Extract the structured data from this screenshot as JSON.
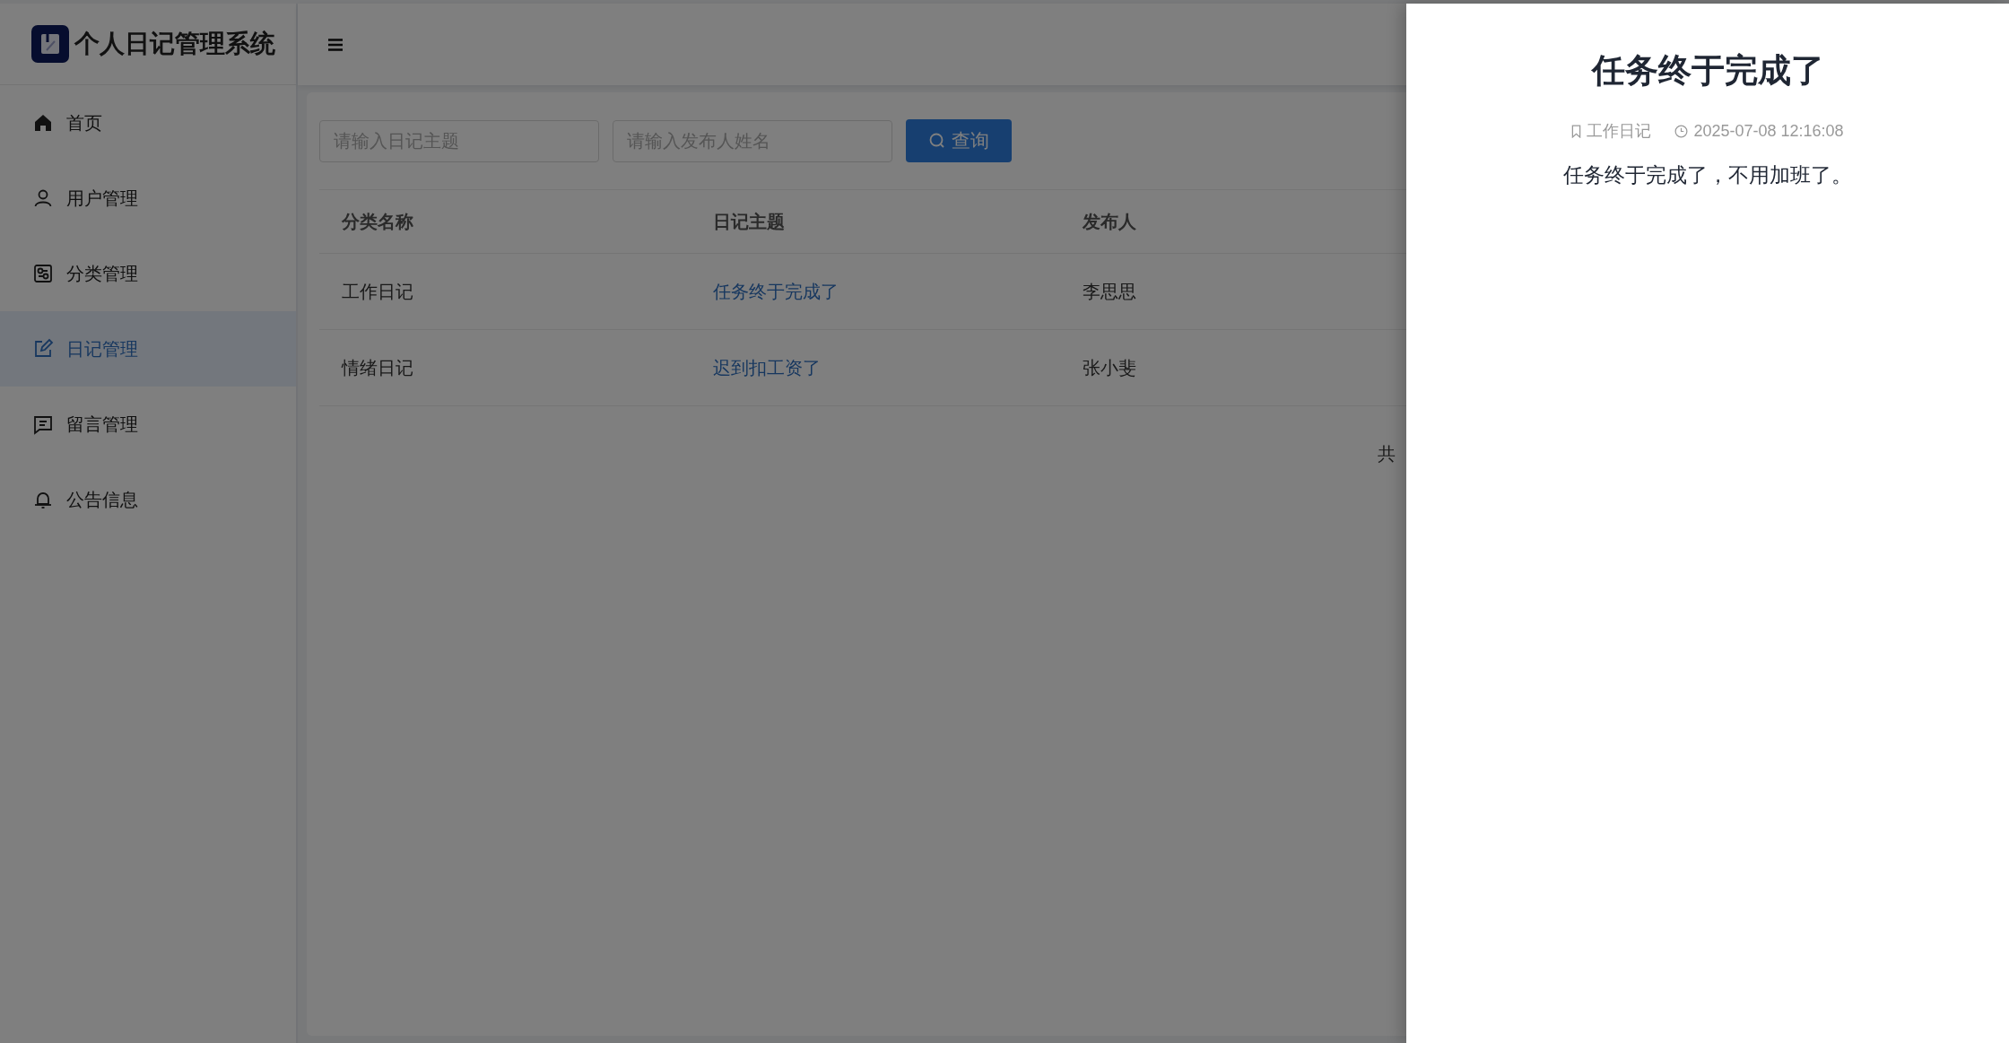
{
  "app": {
    "title": "个人日记管理系统"
  },
  "sidebar": {
    "items": [
      {
        "label": "首页",
        "kind": "home",
        "selected": false
      },
      {
        "label": "用户管理",
        "kind": "user",
        "selected": false
      },
      {
        "label": "分类管理",
        "kind": "category",
        "selected": false
      },
      {
        "label": "日记管理",
        "kind": "diary",
        "selected": true
      },
      {
        "label": "留言管理",
        "kind": "message",
        "selected": false
      },
      {
        "label": "公告信息",
        "kind": "notice",
        "selected": false
      }
    ]
  },
  "search": {
    "fields": [
      {
        "placeholder": "请输入日记主题"
      },
      {
        "placeholder": "请输入发布人姓名"
      }
    ],
    "button": "查询"
  },
  "table": {
    "columns": [
      "分类名称",
      "日记主题",
      "发布人"
    ],
    "rows": [
      {
        "category": "工作日记",
        "topic": "任务终于完成了",
        "author": "李思思"
      },
      {
        "category": "情绪日记",
        "topic": "迟到扣工资了",
        "author": "张小斐"
      }
    ]
  },
  "pagination": {
    "total_text": "共"
  },
  "drawer": {
    "title": "任务终于完成了",
    "category": "工作日记",
    "time": "2025-07-08 12:16:08",
    "content": "任务终于完成了，不用加班了。"
  }
}
